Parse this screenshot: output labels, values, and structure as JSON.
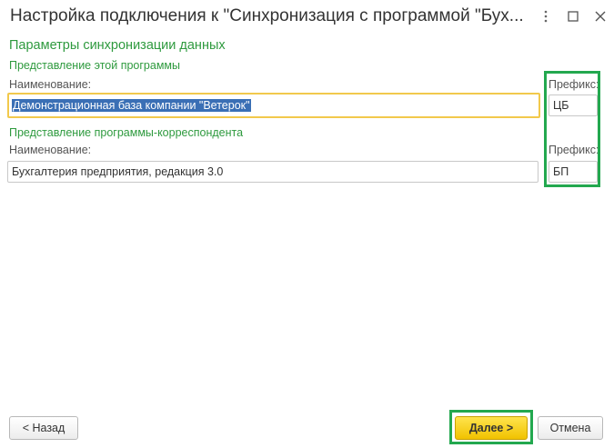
{
  "window": {
    "title": "Настройка подключения к \"Синхронизация с программой \"Бух..."
  },
  "form": {
    "section_title": "Параметры синхронизации данных",
    "this_program": {
      "title": "Представление этой программы",
      "name_label": "Наименование:",
      "name_value": "Демонстрационная база компании \"Ветерок\"",
      "prefix_label": "Префикс:",
      "prefix_value": "ЦБ"
    },
    "correspondent": {
      "title": "Представление программы-корреспондента",
      "name_label": "Наименование:",
      "name_value": "Бухгалтерия предприятия, редакция 3.0",
      "prefix_label": "Префикс:",
      "prefix_value": "БП"
    }
  },
  "footer": {
    "back_label": "< Назад",
    "next_label": "Далее >",
    "cancel_label": "Отмена"
  },
  "colors": {
    "accent_green": "#2e9a3e",
    "highlight_green": "#23a84f",
    "primary_button": "#f5cc16",
    "focus_border": "#f2c94c",
    "selection": "#3a6fb5"
  },
  "icons": [
    "more-vertical-icon",
    "maximize-icon",
    "close-icon"
  ]
}
